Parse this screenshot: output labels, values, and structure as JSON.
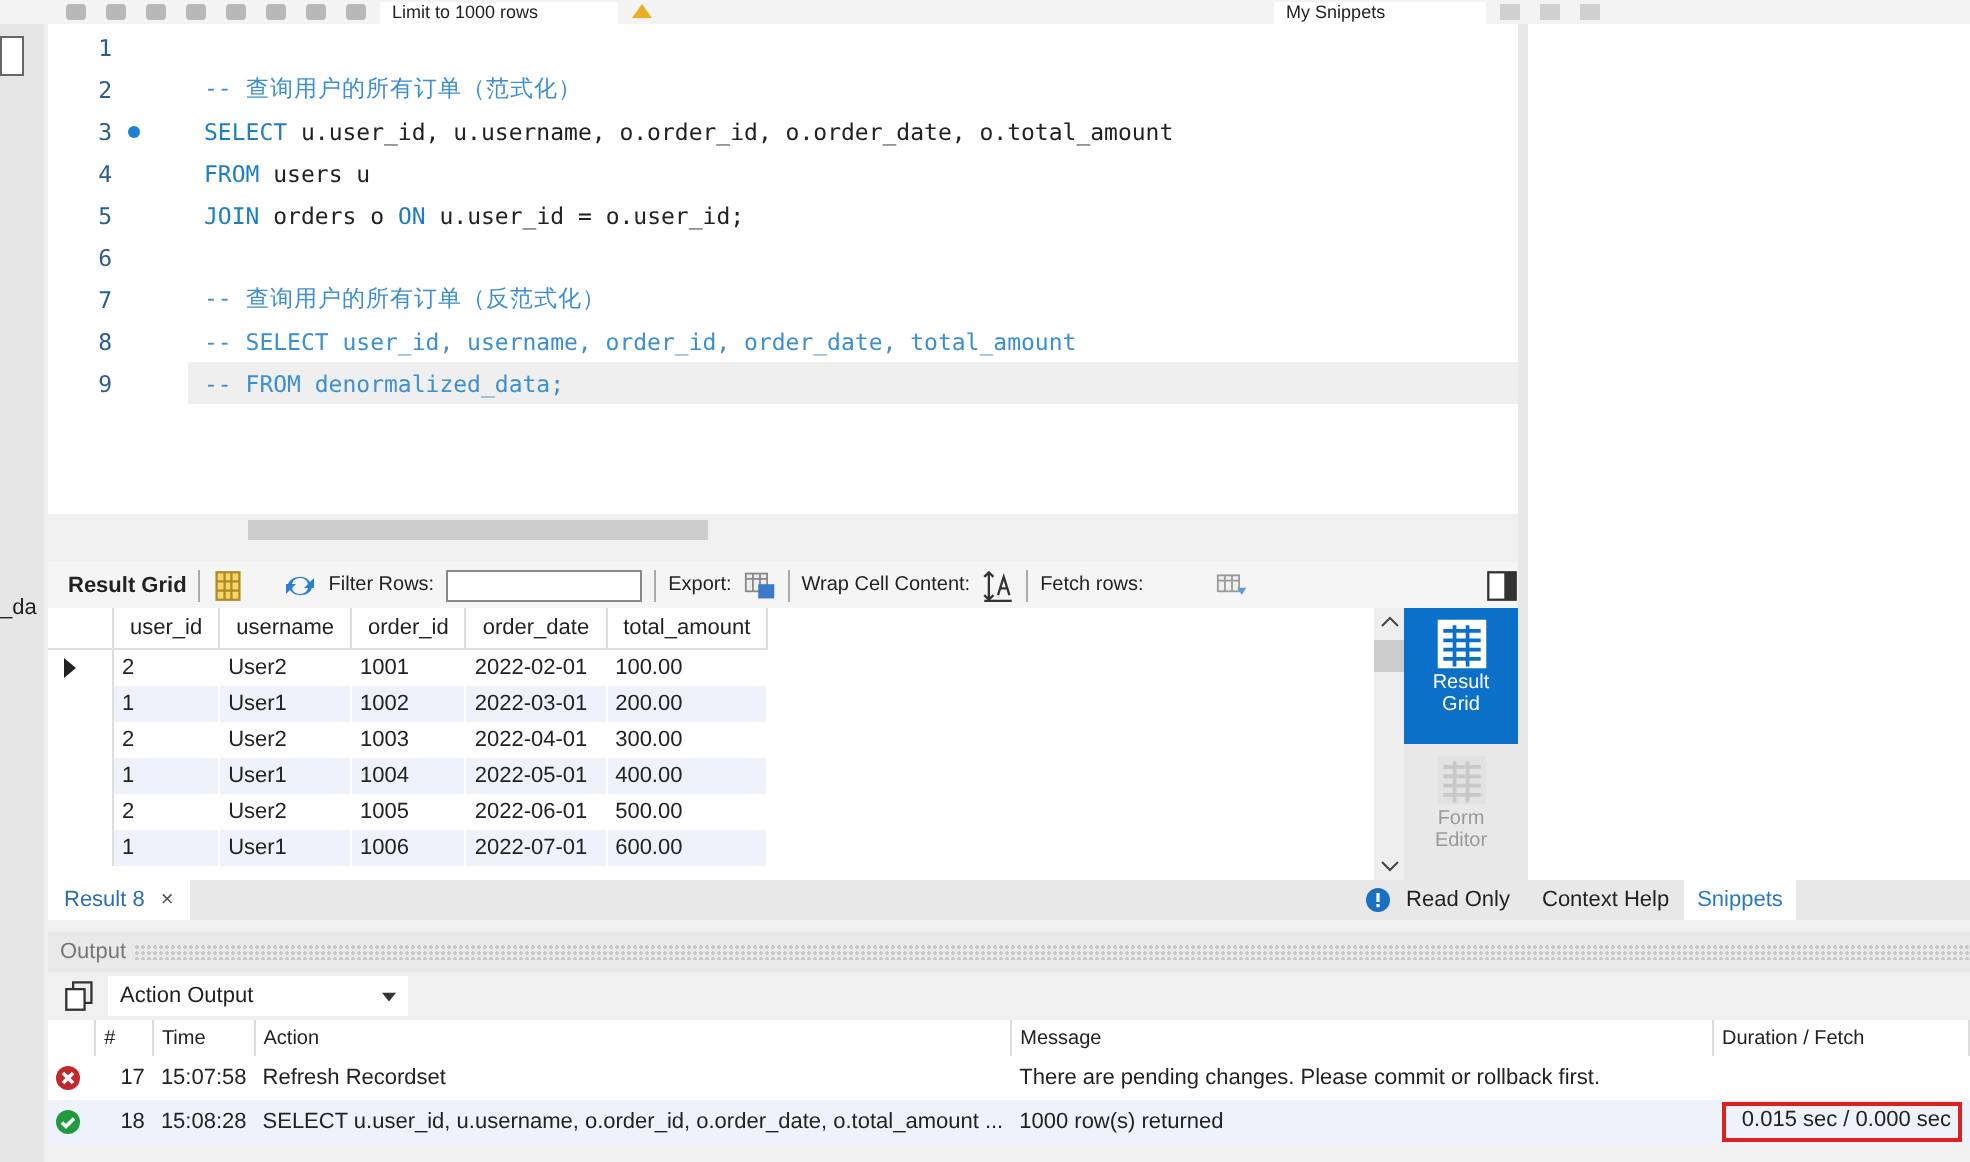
{
  "toolbar": {
    "limit_select": "Limit to 1000 rows",
    "snippets_select": "My Snippets"
  },
  "sidebar": {
    "cut_text": "_da"
  },
  "editor": {
    "lines": [
      {
        "number": "1",
        "marker": false,
        "current": false
      },
      {
        "number": "2",
        "marker": false,
        "current": false,
        "tokens": [
          {
            "kind": "comment",
            "text": "-- 查询用户的所有订单（范式化）"
          }
        ]
      },
      {
        "number": "3",
        "marker": true,
        "current": false,
        "tokens": [
          {
            "kind": "keyword",
            "text": "SELECT"
          },
          {
            "kind": "plain",
            "text": " u.user_id, u.username, o.order_id, o.order_date, o.total_amount"
          }
        ]
      },
      {
        "number": "4",
        "marker": false,
        "current": false,
        "tokens": [
          {
            "kind": "keyword",
            "text": "FROM"
          },
          {
            "kind": "plain",
            "text": " users u"
          }
        ]
      },
      {
        "number": "5",
        "marker": false,
        "current": false,
        "tokens": [
          {
            "kind": "keyword",
            "text": "JOIN"
          },
          {
            "kind": "plain",
            "text": " orders o "
          },
          {
            "kind": "keyword",
            "text": "ON"
          },
          {
            "kind": "plain",
            "text": " u.user_id = o.user_id;"
          }
        ]
      },
      {
        "number": "6",
        "marker": false,
        "current": false
      },
      {
        "number": "7",
        "marker": false,
        "current": false,
        "tokens": [
          {
            "kind": "comment",
            "text": "-- 查询用户的所有订单（反范式化）"
          }
        ]
      },
      {
        "number": "8",
        "marker": false,
        "current": false,
        "tokens": [
          {
            "kind": "comment",
            "text": "-- SELECT user_id, username, order_id, order_date, total_amount"
          }
        ]
      },
      {
        "number": "9",
        "marker": false,
        "current": true,
        "tokens": [
          {
            "kind": "comment",
            "text": "-- FROM denormalized_data;"
          }
        ]
      }
    ]
  },
  "result_toolbar": {
    "result_grid_label": "Result Grid",
    "filter_label": "Filter Rows:",
    "export_label": "Export:",
    "wrap_label": "Wrap Cell Content:",
    "fetch_label": "Fetch rows:"
  },
  "result_grid": {
    "columns": [
      "user_id",
      "username",
      "order_id",
      "order_date",
      "total_amount"
    ],
    "rows": [
      {
        "selected": true,
        "cells": [
          "2",
          "User2",
          "1001",
          "2022-02-01",
          "100.00"
        ]
      },
      {
        "selected": false,
        "cells": [
          "1",
          "User1",
          "1002",
          "2022-03-01",
          "200.00"
        ]
      },
      {
        "selected": false,
        "cells": [
          "2",
          "User2",
          "1003",
          "2022-04-01",
          "300.00"
        ]
      },
      {
        "selected": false,
        "cells": [
          "1",
          "User1",
          "1004",
          "2022-05-01",
          "400.00"
        ]
      },
      {
        "selected": false,
        "cells": [
          "2",
          "User2",
          "1005",
          "2022-06-01",
          "500.00"
        ]
      },
      {
        "selected": false,
        "cells": [
          "1",
          "User1",
          "1006",
          "2022-07-01",
          "600.00"
        ]
      }
    ]
  },
  "view_buttons": [
    {
      "label": "Result Grid",
      "selected": true
    },
    {
      "label": "Form Editor",
      "selected": false
    }
  ],
  "result_tabs": [
    {
      "label": "Result 8",
      "close": "×"
    }
  ],
  "read_only": "Read Only",
  "side_tabs": [
    {
      "label": "Context Help",
      "selected": false
    },
    {
      "label": "Snippets",
      "selected": true
    }
  ],
  "output": {
    "title": "Output",
    "mode_select": "Action Output",
    "columns": [
      "#",
      "Time",
      "Action",
      "Message",
      "Duration / Fetch"
    ],
    "rows": [
      {
        "kind": "error",
        "number": "17",
        "time": "15:07:58",
        "action": "Refresh Recordset",
        "message": "There are pending changes. Please commit or rollback first."
      },
      {
        "kind": "ok",
        "highlighted": true,
        "number": "18",
        "time": "15:08:28",
        "action": "SELECT u.user_id, u.username, o.order_id, o.order_date, o.total_amount ...",
        "message": "1000 row(s) returned",
        "duration": "0.015 sec / 0.000 sec"
      }
    ]
  }
}
